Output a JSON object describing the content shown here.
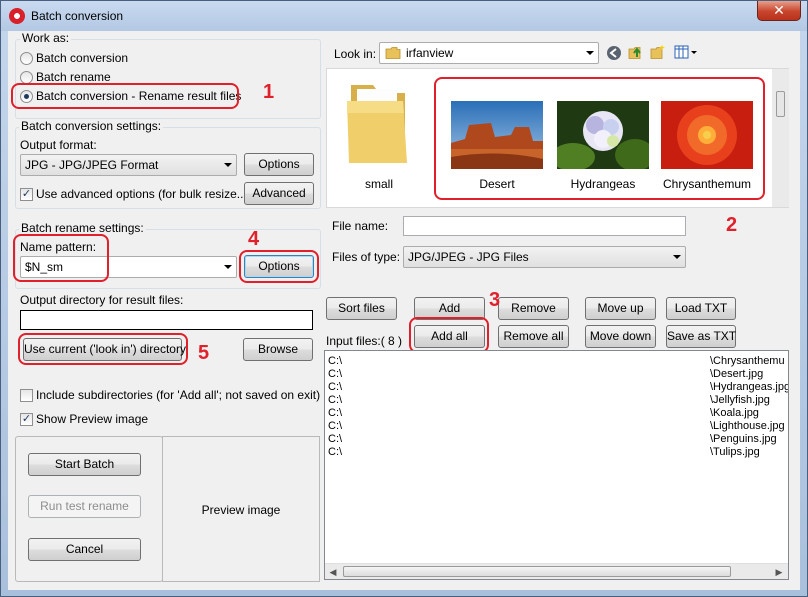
{
  "window": {
    "title": "Batch conversion",
    "close_glyph": "✕"
  },
  "work_as": {
    "label": "Work as:",
    "options": [
      "Batch conversion",
      "Batch rename",
      "Batch conversion - Rename result files"
    ],
    "selected_index": 2
  },
  "conversion_settings": {
    "label": "Batch conversion settings:",
    "output_format_label": "Output format:",
    "output_format_value": "JPG - JPG/JPEG Format",
    "options_button": "Options",
    "advanced_checkbox_label": "Use advanced options (for bulk resize...)",
    "advanced_checked": true,
    "advanced_button": "Advanced"
  },
  "rename_settings": {
    "label": "Batch rename settings:",
    "name_pattern_label": "Name pattern:",
    "name_pattern_value": "$N_sm",
    "options_button": "Options"
  },
  "output_dir": {
    "label": "Output directory for result files:",
    "value": "",
    "use_current_button": "Use current ('look in') directory",
    "browse_button": "Browse"
  },
  "options": {
    "include_subdirs_label": "Include subdirectories (for 'Add all'; not saved on exit)",
    "include_subdirs_checked": false,
    "show_preview_label": "Show Preview image",
    "show_preview_checked": true
  },
  "actions": {
    "start_batch": "Start Batch",
    "run_test_rename": "Run test rename",
    "cancel": "Cancel"
  },
  "preview": {
    "label": "Preview image"
  },
  "browser": {
    "look_in_label": "Look in:",
    "look_in_value": "irfanview",
    "thumbnails": [
      {
        "label": "small",
        "kind": "folder"
      },
      {
        "label": "Desert",
        "kind": "image"
      },
      {
        "label": "Hydrangeas",
        "kind": "image"
      },
      {
        "label": "Chrysanthemum",
        "kind": "image"
      }
    ],
    "file_name_label": "File name:",
    "file_name_value": "",
    "file_type_label": "Files of type:",
    "file_type_value": "JPG/JPEG - JPG Files"
  },
  "list_buttons": {
    "sort_files": "Sort files",
    "add": "Add",
    "remove": "Remove",
    "move_up": "Move up",
    "load_txt": "Load TXT",
    "add_all": "Add all",
    "remove_all": "Remove all",
    "move_down": "Move down",
    "save_as_txt": "Save as TXT"
  },
  "input_files": {
    "label": "Input files:( 8 )",
    "rows": [
      {
        "path": "C:\\",
        "file": "\\Chrysanthemu"
      },
      {
        "path": "C:\\",
        "file": "\\Desert.jpg"
      },
      {
        "path": "C:\\",
        "file": "\\Hydrangeas.jpg"
      },
      {
        "path": "C:\\",
        "file": "\\Jellyfish.jpg"
      },
      {
        "path": "C:\\",
        "file": "\\Koala.jpg"
      },
      {
        "path": "C:\\",
        "file": "\\Lighthouse.jpg"
      },
      {
        "path": "C:\\",
        "file": "\\Penguins.jpg"
      },
      {
        "path": "C:\\",
        "file": "\\Tulips.jpg"
      }
    ]
  },
  "annotations": [
    "1",
    "2",
    "3",
    "4",
    "5"
  ],
  "colors": {
    "annotation": "#e0202a",
    "window_frame": "#b3c8e4",
    "dialog_bg": "#f0f0f0"
  },
  "icons": [
    "app-icon",
    "folder-icon",
    "back-icon",
    "up-folder-icon",
    "new-folder-icon",
    "view-menu-icon"
  ]
}
